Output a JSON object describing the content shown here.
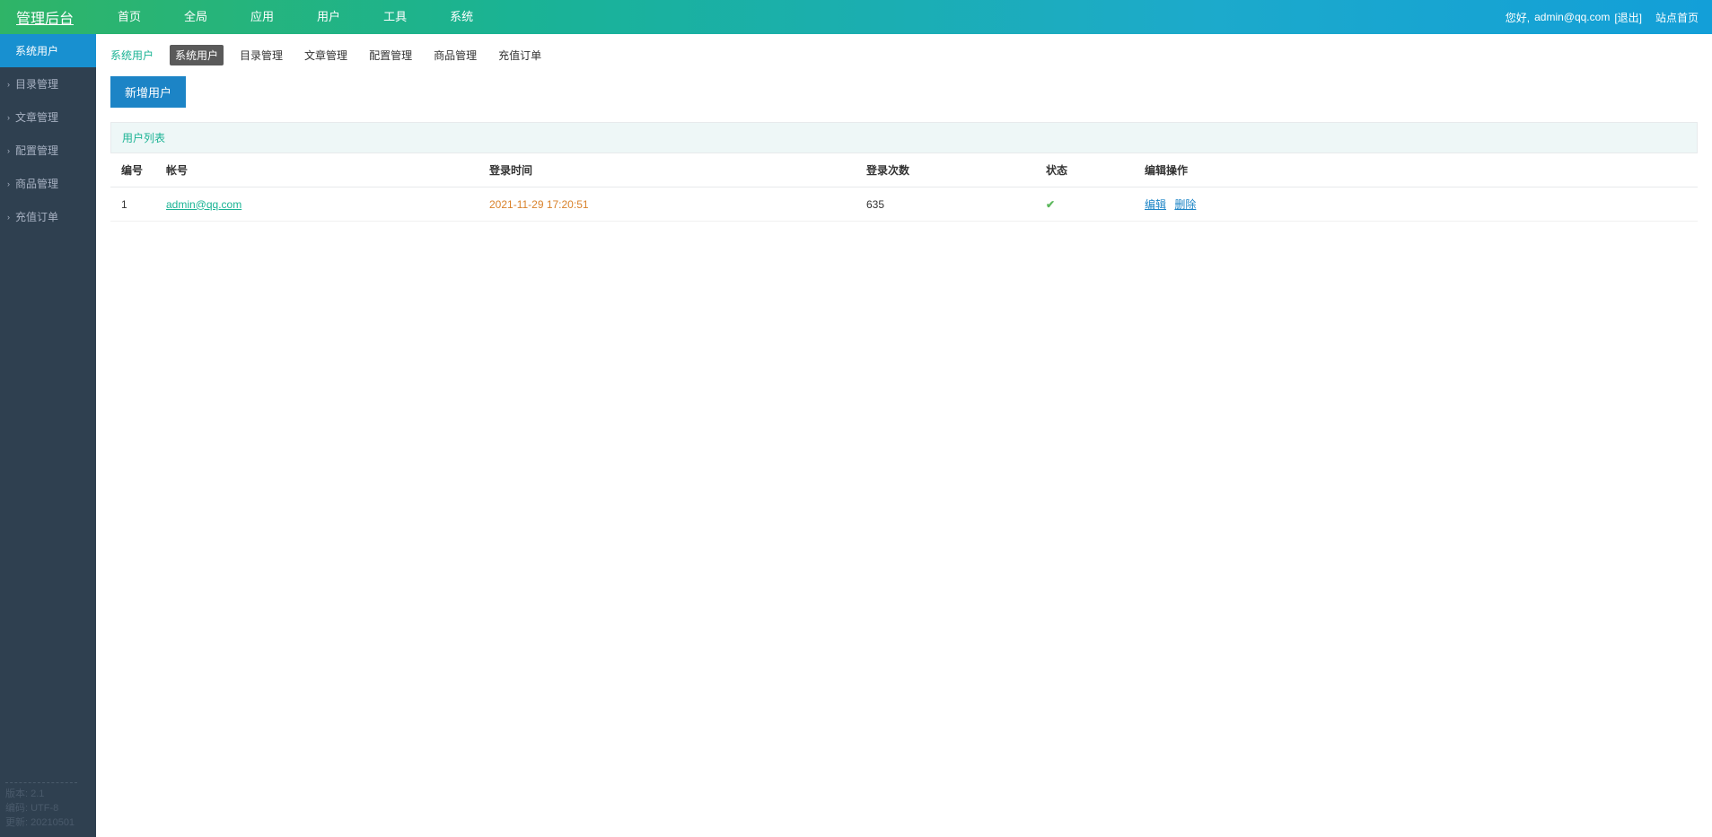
{
  "header": {
    "logo": "管理后台",
    "menu": [
      "首页",
      "全局",
      "应用",
      "用户",
      "工具",
      "系统"
    ],
    "welcome_prefix": "您好, ",
    "user_email": "admin@qq.com",
    "logout": "[退出]",
    "site_home": "站点首页"
  },
  "sidebar": {
    "items": [
      {
        "label": "系统用户",
        "active": true
      },
      {
        "label": "目录管理",
        "active": false
      },
      {
        "label": "文章管理",
        "active": false
      },
      {
        "label": "配置管理",
        "active": false
      },
      {
        "label": "商品管理",
        "active": false
      },
      {
        "label": "充值订单",
        "active": false
      }
    ],
    "footer": {
      "version": "版本: 2.1",
      "encoding": "编码: UTF-8",
      "update": "更新: 20210501"
    }
  },
  "subnav": {
    "breadcrumb": "系统用户",
    "tabs": [
      {
        "label": "系统用户",
        "active": true
      },
      {
        "label": "目录管理",
        "active": false
      },
      {
        "label": "文章管理",
        "active": false
      },
      {
        "label": "配置管理",
        "active": false
      },
      {
        "label": "商品管理",
        "active": false
      },
      {
        "label": "充值订单",
        "active": false
      }
    ]
  },
  "content": {
    "add_button": "新增用户",
    "panel_title": "用户列表",
    "columns": {
      "id": "编号",
      "account": "帐号",
      "login_time": "登录时间",
      "login_count": "登录次数",
      "status": "状态",
      "actions": "编辑操作"
    },
    "rows": [
      {
        "id": "1",
        "account": "admin@qq.com",
        "login_time": "2021-11-29 17:20:51",
        "login_count": "635",
        "edit": "编辑",
        "delete": "删除"
      }
    ]
  }
}
